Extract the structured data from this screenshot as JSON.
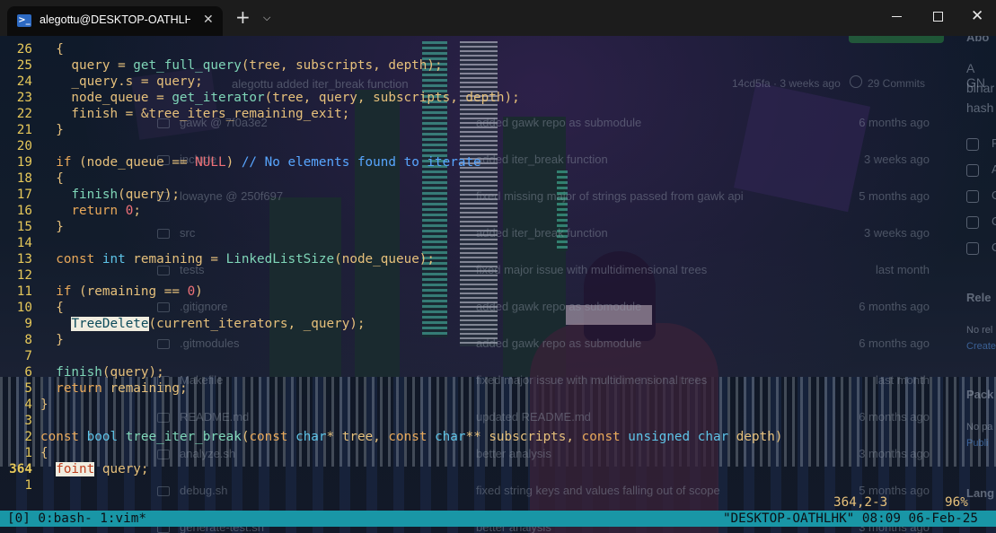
{
  "window": {
    "tab_title": "alegottu@DESKTOP-OATHLHK",
    "tab_icon": "powershell-icon",
    "close_tab_glyph": "✕",
    "new_tab_glyph": "+",
    "dropdown_glyph": "⌵",
    "close_glyph": "✕"
  },
  "background_github": {
    "header_commit": "alegottu  added iter_break function",
    "header_hash": "14cd5fa · 3 weeks ago",
    "commits": "29 Commits",
    "rows": [
      {
        "name": "gawk @ 7f0a3e2",
        "msg": "added gawk repo as submodule",
        "date": "6 months ago"
      },
      {
        "name": "include",
        "msg": "added iter_break function",
        "date": "3 weeks ago"
      },
      {
        "name": "lowayne @ 250f697",
        "msg": "fixed missing major of strings passed from gawk api",
        "date": "5 months ago"
      },
      {
        "name": "src",
        "msg": "added iter_break function",
        "date": "3 weeks ago"
      },
      {
        "name": "tests",
        "msg": "fixed major issue with multidimensional trees",
        "date": "last month"
      },
      {
        "name": ".gitignore",
        "msg": "added gawk repo as submodule",
        "date": "6 months ago"
      },
      {
        "name": ".gitmodules",
        "msg": "added gawk repo as submodule",
        "date": "6 months ago"
      },
      {
        "name": "Makefile",
        "msg": "fixed major issue with multidimensional trees",
        "date": "last month"
      },
      {
        "name": "README.md",
        "msg": "updated README.md",
        "date": "6 months ago"
      },
      {
        "name": "analyze.sh",
        "msg": "better analysis",
        "date": "3 months ago"
      },
      {
        "name": "debug.sh",
        "msg": "fixed string keys and values falling out of scope",
        "date": "5 months ago"
      },
      {
        "name": "generate-test.sh",
        "msg": "better analysis",
        "date": "3 months ago"
      }
    ],
    "side": {
      "title": "Abo",
      "desc_1": "A GN",
      "desc_2": "binar",
      "desc_3": "hash",
      "letters": [
        "R",
        "A",
        "O",
        "O",
        "O"
      ],
      "releases": "Rele",
      "no_releases": "No rel",
      "create": "Create",
      "packages": "Pack",
      "no_packages": "No pa",
      "publish": "Publi",
      "languages": "Lang"
    }
  },
  "vim": {
    "lines": [
      {
        "num": "26",
        "tokens": [
          [
            "  ",
            "id"
          ],
          [
            "{",
            "id"
          ]
        ]
      },
      {
        "num": "25",
        "tokens": [
          [
            "    query = ",
            "id"
          ],
          [
            "get_full_query",
            "fn"
          ],
          [
            "(tree, subscripts, depth);",
            "id"
          ]
        ]
      },
      {
        "num": "24",
        "tokens": [
          [
            "    _query.s = query;",
            "id"
          ]
        ]
      },
      {
        "num": "23",
        "tokens": [
          [
            "    node_queue = ",
            "id"
          ],
          [
            "get_iterator",
            "fn"
          ],
          [
            "(tree, query, subscripts, depth);",
            "id"
          ]
        ]
      },
      {
        "num": "22",
        "tokens": [
          [
            "    finish = &tree_iters_remaining_exit;",
            "id"
          ]
        ]
      },
      {
        "num": "21",
        "tokens": [
          [
            "  }",
            "id"
          ]
        ]
      },
      {
        "num": "20",
        "tokens": []
      },
      {
        "num": "19",
        "tokens": [
          [
            "  ",
            "id"
          ],
          [
            "if",
            "kw"
          ],
          [
            " (node_queue == ",
            "id"
          ],
          [
            "NULL",
            "nul"
          ],
          [
            ") ",
            "id"
          ],
          [
            "// No elements found to iterate",
            "cm"
          ]
        ]
      },
      {
        "num": "18",
        "tokens": [
          [
            "  {",
            "id"
          ]
        ]
      },
      {
        "num": "17",
        "tokens": [
          [
            "    ",
            "id"
          ],
          [
            "finish",
            "fn"
          ],
          [
            "(query);",
            "id"
          ]
        ]
      },
      {
        "num": "16",
        "tokens": [
          [
            "    ",
            "id"
          ],
          [
            "return",
            "kw"
          ],
          [
            " ",
            "id"
          ],
          [
            "0",
            "num"
          ],
          [
            ";",
            "id"
          ]
        ]
      },
      {
        "num": "15",
        "tokens": [
          [
            "  }",
            "id"
          ]
        ]
      },
      {
        "num": "14",
        "tokens": []
      },
      {
        "num": "13",
        "tokens": [
          [
            "  ",
            "id"
          ],
          [
            "const",
            "kw"
          ],
          [
            " ",
            "id"
          ],
          [
            "int",
            "type"
          ],
          [
            " remaining = ",
            "id"
          ],
          [
            "LinkedListSize",
            "fn"
          ],
          [
            "(node_queue);",
            "id"
          ]
        ]
      },
      {
        "num": "12",
        "tokens": []
      },
      {
        "num": "11",
        "tokens": [
          [
            "  ",
            "id"
          ],
          [
            "if",
            "kw"
          ],
          [
            " (remaining == ",
            "id"
          ],
          [
            "0",
            "num"
          ],
          [
            ")",
            "id"
          ]
        ]
      },
      {
        "num": "10",
        "tokens": [
          [
            "  {",
            "id"
          ]
        ]
      },
      {
        "num": "9",
        "tokens": [
          [
            "    ",
            "id"
          ],
          [
            "TreeDelete",
            "hl-match"
          ],
          [
            "(current_iterators, _query);",
            "id"
          ]
        ]
      },
      {
        "num": "8",
        "tokens": [
          [
            "  }",
            "id"
          ]
        ]
      },
      {
        "num": "7",
        "tokens": []
      },
      {
        "num": "6",
        "tokens": [
          [
            "  ",
            "id"
          ],
          [
            "finish",
            "fn"
          ],
          [
            "(query);",
            "id"
          ]
        ]
      },
      {
        "num": "5",
        "tokens": [
          [
            "  ",
            "id"
          ],
          [
            "return",
            "kw"
          ],
          [
            " remaining;",
            "id"
          ]
        ]
      },
      {
        "num": "4",
        "tokens": [
          [
            "}",
            "id"
          ]
        ],
        "indent": -1
      },
      {
        "num": "3",
        "tokens": []
      },
      {
        "num": "2",
        "tokens": [
          [
            "const",
            "kw"
          ],
          [
            " ",
            "id"
          ],
          [
            "bool",
            "type"
          ],
          [
            " ",
            "id"
          ],
          [
            "tree_iter_break",
            "fn"
          ],
          [
            "(",
            "id"
          ],
          [
            "const",
            "kw"
          ],
          [
            " ",
            "id"
          ],
          [
            "char",
            "type"
          ],
          [
            "* tree, ",
            "id"
          ],
          [
            "const",
            "kw"
          ],
          [
            " ",
            "id"
          ],
          [
            "char",
            "type"
          ],
          [
            "** subscripts, ",
            "id"
          ],
          [
            "const",
            "kw"
          ],
          [
            " ",
            "id"
          ],
          [
            "unsigned",
            "type"
          ],
          [
            " ",
            "id"
          ],
          [
            "char",
            "type"
          ],
          [
            " depth)",
            "id"
          ]
        ],
        "indent": -1
      },
      {
        "num": "1",
        "tokens": [
          [
            "{",
            "id"
          ]
        ],
        "indent": -1
      },
      {
        "num": "364",
        "tokens": [
          [
            "  ",
            "id"
          ],
          [
            "foint",
            "hl-err"
          ],
          [
            " query;",
            "id"
          ]
        ],
        "current": true,
        "indent": -1
      },
      {
        "num": "1",
        "tokens": []
      }
    ],
    "ruler_position": "364,2-3",
    "ruler_percent": "96%"
  },
  "tmux": {
    "left": "[0] 0:bash- 1:vim*",
    "right": "\"DESKTOP-OATHLHK\" 08:09 06-Feb-25"
  },
  "colors": {
    "tmux_bar": "#1996a6",
    "line_number": "#e6c85a",
    "comment": "#58a6ff"
  }
}
